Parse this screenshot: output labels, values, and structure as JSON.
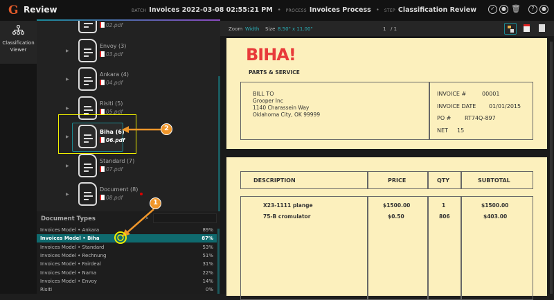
{
  "header": {
    "logo": "G",
    "title": "Review",
    "batch_label": "BATCH",
    "batch": "Invoices 2022-03-08 02:55:21 PM",
    "process_label": "PROCESS",
    "process": "Invoices Process",
    "step_label": "STEP",
    "step": "Classification Review"
  },
  "sidebar": {
    "item_label": "Classification Viewer"
  },
  "tree": {
    "nodes": [
      {
        "name": "",
        "file": "02.pdf"
      },
      {
        "name": "Envoy (3)",
        "file": "03.pdf"
      },
      {
        "name": "Ankara (4)",
        "file": "04.pdf"
      },
      {
        "name": "Risiti (5)",
        "file": "05.pdf"
      },
      {
        "name": "Biha (6)",
        "file": "06.pdf"
      },
      {
        "name": "Standard (7)",
        "file": "07.pdf"
      },
      {
        "name": "Document (8)",
        "file": "08.pdf"
      }
    ]
  },
  "doc_types": {
    "title": "Document Types",
    "rows": [
      {
        "name": "Invoices Model • Ankara",
        "pct": "89%"
      },
      {
        "name": "Invoices Model • Biha",
        "pct": "87%"
      },
      {
        "name": "Invoices Model • Standard",
        "pct": "53%"
      },
      {
        "name": "Invoices Model • Rechnung",
        "pct": "51%"
      },
      {
        "name": "Invoices Model • Fairdeal",
        "pct": "31%"
      },
      {
        "name": "Invoices Model • Nama",
        "pct": "22%"
      },
      {
        "name": "Invoices Model • Envoy",
        "pct": "14%"
      },
      {
        "name": "Risiti",
        "pct": "0%"
      }
    ]
  },
  "viewer": {
    "zoom_label": "Zoom",
    "zoom": "Width",
    "size_label": "Size",
    "size": "8.50\" x 11.00\"",
    "page": "1",
    "of": "/ 1"
  },
  "invoice": {
    "brand": "BIHA!",
    "tagline": "PARTS & SERVICE",
    "bill_to": "BILL TO",
    "company": "Grooper Inc",
    "address1": "1140 Charassein Way",
    "address2": "Oklahoma City, OK 99999",
    "inv_no_label": "INVOICE #",
    "inv_no": "00001",
    "date_label": "INVOICE DATE",
    "date": "01/01/2015",
    "po_label": "PO #",
    "po": "RT74Q-897",
    "net_label": "NET",
    "net": "15",
    "cols": [
      "DESCRIPTION",
      "PRICE",
      "QTY",
      "SUBTOTAL"
    ],
    "items": [
      [
        "X23-1111 plange",
        "$1500.00",
        "1",
        "$1500.00"
      ],
      [
        "75-B cromulator",
        "$0.50",
        "806",
        "$403.00"
      ]
    ]
  },
  "callouts": [
    "1",
    "2"
  ],
  "colors": {
    "accent": "#0f6a6e",
    "callout": "#f0962a",
    "highlight": "#f5f500"
  }
}
